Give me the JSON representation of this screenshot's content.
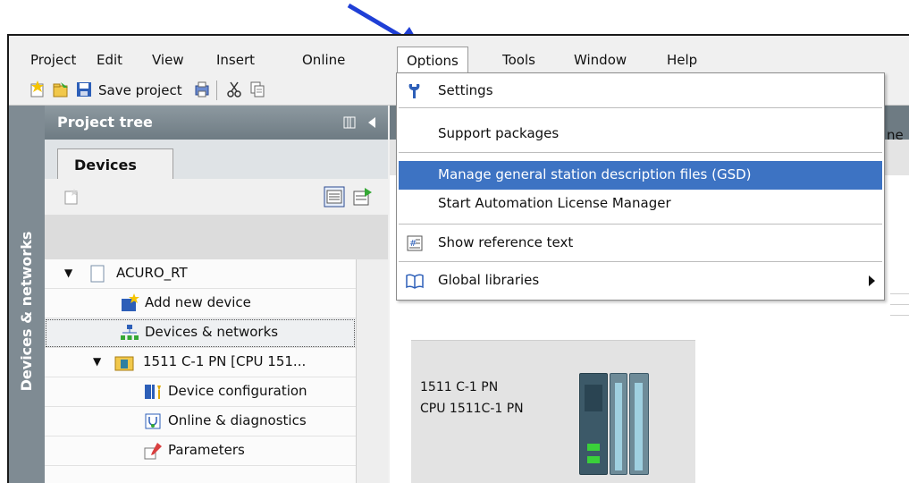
{
  "menubar": {
    "items": [
      "Project",
      "Edit",
      "View",
      "Insert",
      "Online",
      "Options",
      "Tools",
      "Window",
      "Help"
    ],
    "active": "Options"
  },
  "toolbar": {
    "save_label": "Save project",
    "truncated_right": "ne"
  },
  "vertical_tab": {
    "label": "Devices & networks"
  },
  "project_tree": {
    "title": "Project tree",
    "tab_label": "Devices",
    "items": [
      "ACURO_RT",
      "Add new device",
      "Devices & networks",
      "1511 C-1 PN [CPU 151...",
      "Device configuration",
      "Online & diagnostics",
      "Parameters"
    ]
  },
  "options_menu": {
    "items": [
      "Settings",
      "Support packages",
      "Manage general station description files (GSD)",
      "Start Automation License Manager",
      "Show reference text",
      "Global libraries"
    ],
    "highlighted": "Manage general station description files (GSD)"
  },
  "device": {
    "name": "1511 C-1 PN",
    "model": "CPU 1511C-1 PN"
  },
  "colors": {
    "accent": "#3d73c3",
    "panel_header": "#7f8b93",
    "arrow": "#1f3fd6"
  }
}
